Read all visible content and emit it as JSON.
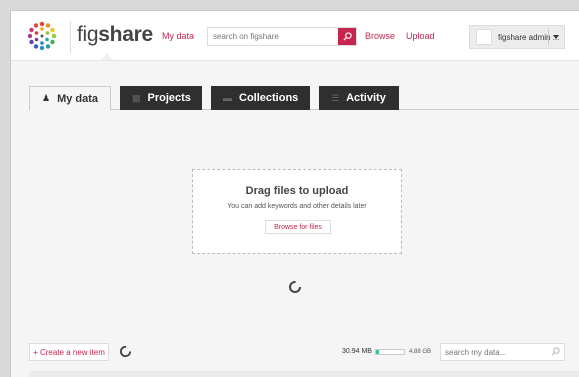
{
  "header": {
    "logo_light": "fig",
    "logo_bold": "share",
    "nav": {
      "my_data": "My data",
      "browse": "Browse",
      "upload": "Upload"
    },
    "search": {
      "placeholder": "search on figshare"
    },
    "user": {
      "name": "figshare admin ..."
    }
  },
  "tabs": [
    {
      "label": "My data",
      "icon": "person-icon",
      "active": true
    },
    {
      "label": "Projects",
      "icon": "folder-icon",
      "active": false
    },
    {
      "label": "Collections",
      "icon": "collection-icon",
      "active": false
    },
    {
      "label": "Activity",
      "icon": "list-icon",
      "active": false
    }
  ],
  "dropzone": {
    "title": "Drag files to upload",
    "subtitle": "You can add keywords and other details later",
    "button": "Browse for files"
  },
  "bottom": {
    "create_label": "+ Create a new item",
    "usage": "30.94 MB",
    "usage_fraction": 0.02,
    "quota": "4.88 GB",
    "search_placeholder": "search my data..."
  },
  "colors": {
    "accent": "#c7254e",
    "tab_dark": "#2f2f2f",
    "usage_fill": "#3cbfa3"
  }
}
